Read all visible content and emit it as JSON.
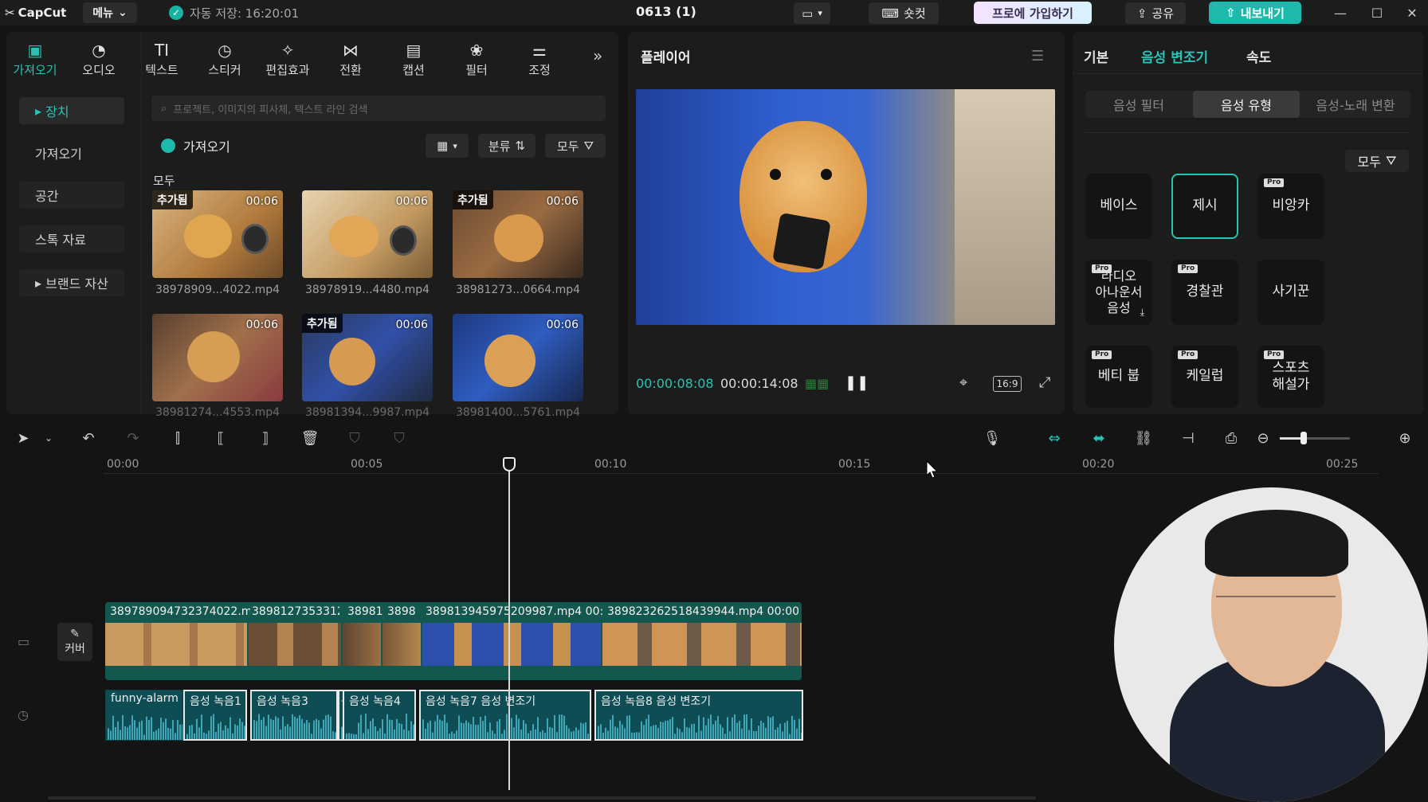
{
  "titlebar": {
    "app_name": "CapCut",
    "menu_label": "메뉴",
    "autosave": "자동 저장: 16:20:01",
    "project_name": "0613 (1)",
    "shortcut_label": "숏컷",
    "pro_label": "프로에 가입하기",
    "share_label": "공유",
    "export_label": "내보내기"
  },
  "media": {
    "tabs": [
      {
        "label": "가져오기",
        "icon": "import-icon"
      },
      {
        "label": "오디오",
        "icon": "audio-icon"
      },
      {
        "label": "텍스트",
        "icon": "text-icon"
      },
      {
        "label": "스티커",
        "icon": "sticker-icon"
      },
      {
        "label": "편집효과",
        "icon": "effects-icon"
      },
      {
        "label": "전환",
        "icon": "transition-icon"
      },
      {
        "label": "캡션",
        "icon": "caption-icon"
      },
      {
        "label": "필터",
        "icon": "filter-icon"
      },
      {
        "label": "조정",
        "icon": "adjust-icon"
      }
    ],
    "sidebar": [
      "장치",
      "가져오기",
      "공간",
      "스톡 자료",
      "브랜드 자산"
    ],
    "search_placeholder": "프로젝트, 이미지의 피사체, 텍스트 라인 검색",
    "import_button": "가져오기",
    "sort_label": "분류",
    "filter_label": "모두",
    "section_label": "모두",
    "items": [
      {
        "name": "38978909...4022.mp4",
        "duration": "00:06",
        "added": "추가됨"
      },
      {
        "name": "38978919...4480.mp4",
        "duration": "00:06",
        "added": ""
      },
      {
        "name": "38981273...0664.mp4",
        "duration": "00:06",
        "added": "추가됨"
      },
      {
        "name": "38981274...4553.mp4",
        "duration": "00:06",
        "added": ""
      },
      {
        "name": "38981394...9987.mp4",
        "duration": "00:06",
        "added": "추가됨"
      },
      {
        "name": "38981400...5761.mp4",
        "duration": "00:06",
        "added": ""
      }
    ]
  },
  "player": {
    "title": "플레이어",
    "current_time": "00:00:08:08",
    "total_time": "00:00:14:08",
    "aspect": "16:9"
  },
  "props": {
    "tabs": [
      "기본",
      "음성 변조기",
      "속도"
    ],
    "active_tab": 1,
    "segments": [
      "음성 필터",
      "음성 유형",
      "음성-노래 변환"
    ],
    "active_segment": 1,
    "filter_label": "모두",
    "pro_badge": "Pro",
    "voices": [
      {
        "label": "베이스",
        "pro": false
      },
      {
        "label": "제시",
        "pro": false,
        "selected": true
      },
      {
        "label": "비앙카",
        "pro": true
      },
      {
        "label": "라디오 아나운서 음성",
        "pro": true
      },
      {
        "label": "경찰관",
        "pro": true
      },
      {
        "label": "사기꾼",
        "pro": false
      },
      {
        "label": "베티 붑",
        "pro": true
      },
      {
        "label": "케일럽",
        "pro": true
      },
      {
        "label": "스포츠 해설가",
        "pro": true
      }
    ]
  },
  "timeline": {
    "ruler": [
      "00:00",
      "00:05",
      "00:10",
      "00:15",
      "00:20",
      "00:25"
    ],
    "cover_label": "커버",
    "video_clips": [
      {
        "label": "38978909473237402​2.m"
      },
      {
        "label": "38981273533​12"
      },
      {
        "label": "38981"
      },
      {
        "label": "3898"
      },
      {
        "label": "38981394597520998​7.mp4  00:"
      },
      {
        "label": "38982326251843​9944.mp4  00:00:"
      }
    ],
    "audio_clips": [
      {
        "label": "funny-alarm"
      },
      {
        "label": "음성 녹음1"
      },
      {
        "label": "음성 녹음3"
      },
      {
        "label": "음"
      },
      {
        "label": "음성 녹음4"
      },
      {
        "label": "음성 녹음7   음성 변조기"
      },
      {
        "label": "음성 녹음8   음성 변조기"
      }
    ]
  },
  "colors": {
    "accent": "#27c3b4",
    "panel": "#1c1c1c",
    "bg": "#141414",
    "track_video": "#14574f",
    "track_audio": "#0f4d55"
  }
}
